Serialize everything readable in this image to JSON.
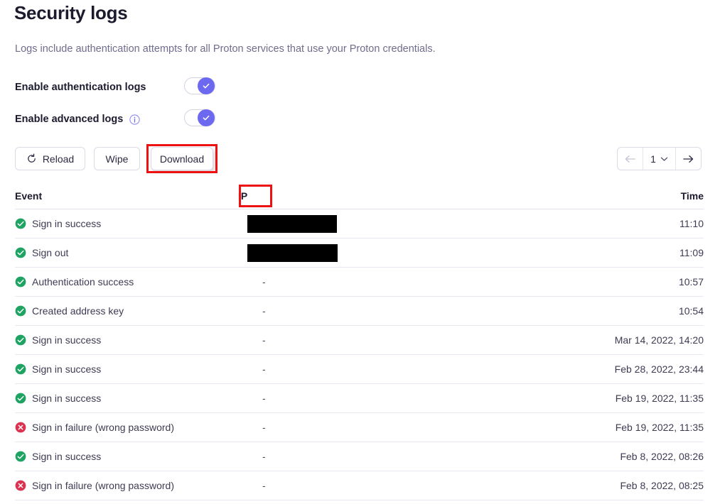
{
  "header": {
    "title": "Security logs",
    "description": "Logs include authentication attempts for all Proton services that use your Proton credentials."
  },
  "settings": {
    "auth_logs": {
      "label": "Enable authentication logs",
      "state": "on"
    },
    "advanced_logs": {
      "label": "Enable advanced logs",
      "info_icon": "info-icon",
      "state": "on"
    }
  },
  "toolbar": {
    "reload_label": "Reload",
    "reload_icon": "refresh-icon",
    "wipe_label": "Wipe",
    "download_label": "Download"
  },
  "pagination": {
    "prev_icon": "arrow-left-icon",
    "page_value": "1",
    "chevron_icon": "chevron-down-icon",
    "next_icon": "arrow-right-icon"
  },
  "table": {
    "columns": {
      "event": "Event",
      "ip": "IP",
      "time": "Time"
    },
    "rows": [
      {
        "status": "success",
        "event": "Sign in success",
        "ip": "",
        "ip_redacted": true,
        "ip_redacted_width": 126,
        "time": "11:10"
      },
      {
        "status": "success",
        "event": "Sign out",
        "ip": "",
        "ip_redacted": true,
        "ip_redacted_width": 127,
        "time": "11:09"
      },
      {
        "status": "success",
        "event": "Authentication success",
        "ip": "-",
        "ip_redacted": false,
        "time": "10:57"
      },
      {
        "status": "success",
        "event": "Created address key",
        "ip": "-",
        "ip_redacted": false,
        "time": "10:54"
      },
      {
        "status": "success",
        "event": "Sign in success",
        "ip": "-",
        "ip_redacted": false,
        "time": "Mar 14, 2022, 14:20"
      },
      {
        "status": "success",
        "event": "Sign in success",
        "ip": "-",
        "ip_redacted": false,
        "time": "Feb 28, 2022, 23:44"
      },
      {
        "status": "success",
        "event": "Sign in success",
        "ip": "-",
        "ip_redacted": false,
        "time": "Feb 19, 2022, 11:35"
      },
      {
        "status": "failure",
        "event": "Sign in failure (wrong password)",
        "ip": "-",
        "ip_redacted": false,
        "time": "Feb 19, 2022, 11:35"
      },
      {
        "status": "success",
        "event": "Sign in success",
        "ip": "-",
        "ip_redacted": false,
        "time": "Feb 8, 2022, 08:26"
      },
      {
        "status": "failure",
        "event": "Sign in failure (wrong password)",
        "ip": "-",
        "ip_redacted": false,
        "time": "Feb 8, 2022, 08:25"
      }
    ]
  },
  "annotations": [
    {
      "target": "download-button",
      "color": "#ee1111"
    },
    {
      "target": "ip-column-header",
      "color": "#ee1111"
    }
  ],
  "colors": {
    "accent": "#6d68f0",
    "success": "#1ea362",
    "failure": "#db3251",
    "title": "#1c1b2e",
    "muted": "#706d8c",
    "annotation": "#ee1111"
  }
}
